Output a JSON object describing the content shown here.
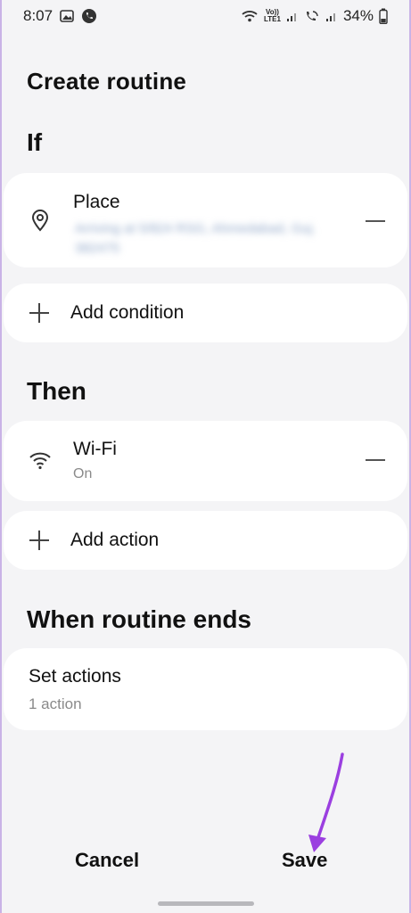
{
  "status_bar": {
    "time": "8:07",
    "battery": "34%",
    "volte_label": "Vo))",
    "lte_label": "LTE1"
  },
  "page": {
    "title": "Create routine"
  },
  "if_section": {
    "heading": "If",
    "condition": {
      "title": "Place",
      "subtitle_blurred": "Arriving at 5/824 RSG, Ahmedabad, Guj. 382475"
    },
    "add_label": "Add condition"
  },
  "then_section": {
    "heading": "Then",
    "action": {
      "title": "Wi-Fi",
      "subtitle": "On"
    },
    "add_label": "Add action"
  },
  "ends_section": {
    "heading": "When routine ends",
    "set_actions": {
      "title": "Set actions",
      "subtitle": "1 action"
    }
  },
  "footer": {
    "cancel_label": "Cancel",
    "save_label": "Save"
  },
  "colors": {
    "background": "#f4f4f6",
    "card": "#ffffff",
    "annotation_arrow": "#9b3fe0"
  }
}
